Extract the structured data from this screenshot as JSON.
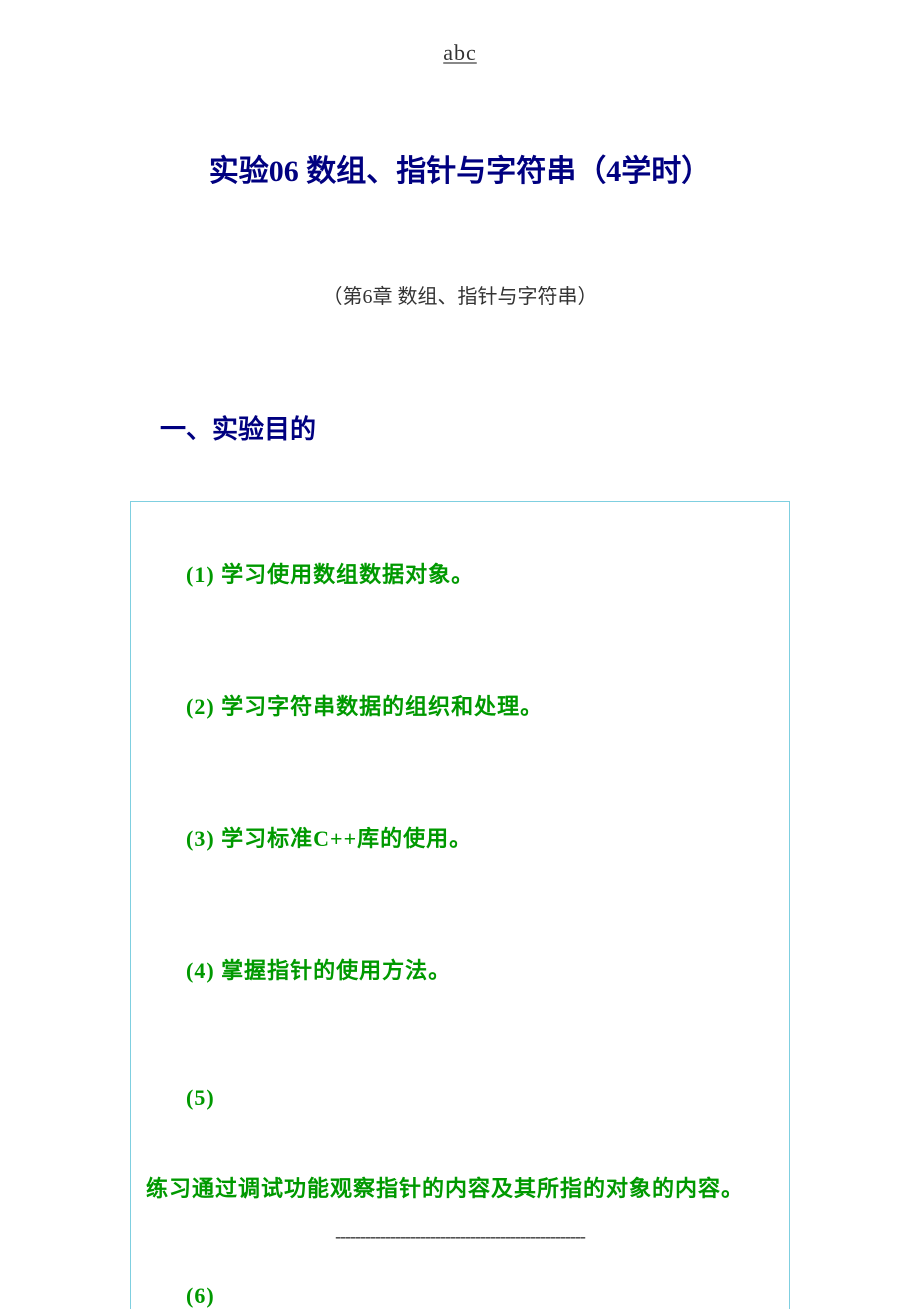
{
  "header": {
    "label": "abc"
  },
  "title": "实验06 数组、指针与字符串（4学时）",
  "subtitle": "（第6章 数组、指针与字符串）",
  "section_heading": "一、实验目的",
  "objectives": {
    "item1": "(1) 学习使用数组数据对象。",
    "item2": "(2) 学习字符串数据的组织和处理。",
    "item3": "(3) 学习标准C++库的使用。",
    "item4": "(4) 掌握指针的使用方法。",
    "item5_marker": "(5)",
    "item5_text": "练习通过调试功能观察指针的内容及其所指的对象的内容。",
    "item6_marker": "(6)"
  },
  "footer": {
    "dashes": "--------------------------------------------------"
  }
}
